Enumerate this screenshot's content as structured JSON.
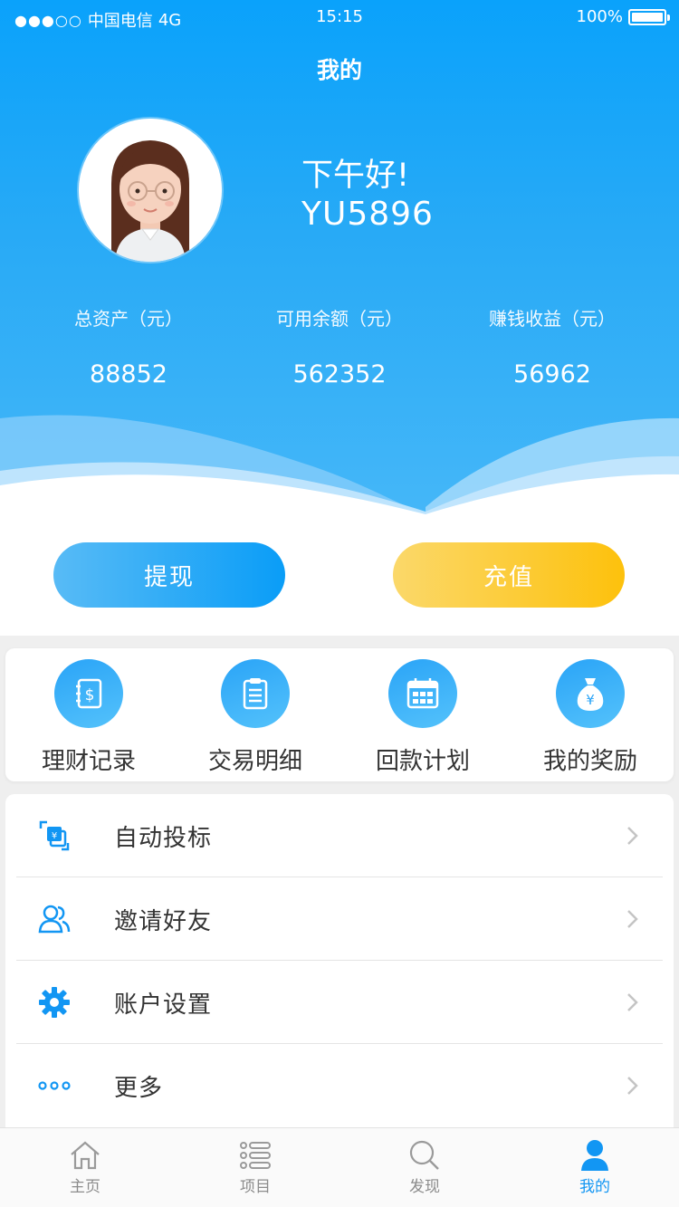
{
  "status_bar": {
    "carrier": "中国电信",
    "network": "4G",
    "time": "15:15",
    "battery": "100%",
    "signal_dots": "●●●○○"
  },
  "header": {
    "title": "我的",
    "greeting": "下午好!",
    "username": "YU5896"
  },
  "stats": [
    {
      "label": "总资产（元）",
      "value": "88852"
    },
    {
      "label": "可用余额（元）",
      "value": "562352"
    },
    {
      "label": "赚钱收益（元）",
      "value": "56962"
    }
  ],
  "actions": {
    "withdraw_label": "提现",
    "recharge_label": "充值"
  },
  "quick_menu": [
    {
      "label": "理财记录",
      "icon": "ledger-dollar-icon"
    },
    {
      "label": "交易明细",
      "icon": "clipboard-list-icon"
    },
    {
      "label": "回款计划",
      "icon": "calendar-icon"
    },
    {
      "label": "我的奖励",
      "icon": "money-bag-icon"
    }
  ],
  "list_menu": [
    {
      "label": "自动投标",
      "icon": "auto-bid-icon"
    },
    {
      "label": "邀请好友",
      "icon": "users-icon"
    },
    {
      "label": "账户设置",
      "icon": "gear-icon"
    },
    {
      "label": "更多",
      "icon": "more-dots-icon"
    }
  ],
  "tabbar": [
    {
      "label": "主页",
      "icon": "home-icon",
      "active": false
    },
    {
      "label": "项目",
      "icon": "list-icon",
      "active": false
    },
    {
      "label": "发现",
      "icon": "search-icon",
      "active": false
    },
    {
      "label": "我的",
      "icon": "person-icon",
      "active": true
    }
  ],
  "colors": {
    "primary": "#1296f3",
    "header_top": "#0aa2fb",
    "recharge": "#fdc10c",
    "text": "#333333",
    "muted": "#8c8c8c"
  }
}
